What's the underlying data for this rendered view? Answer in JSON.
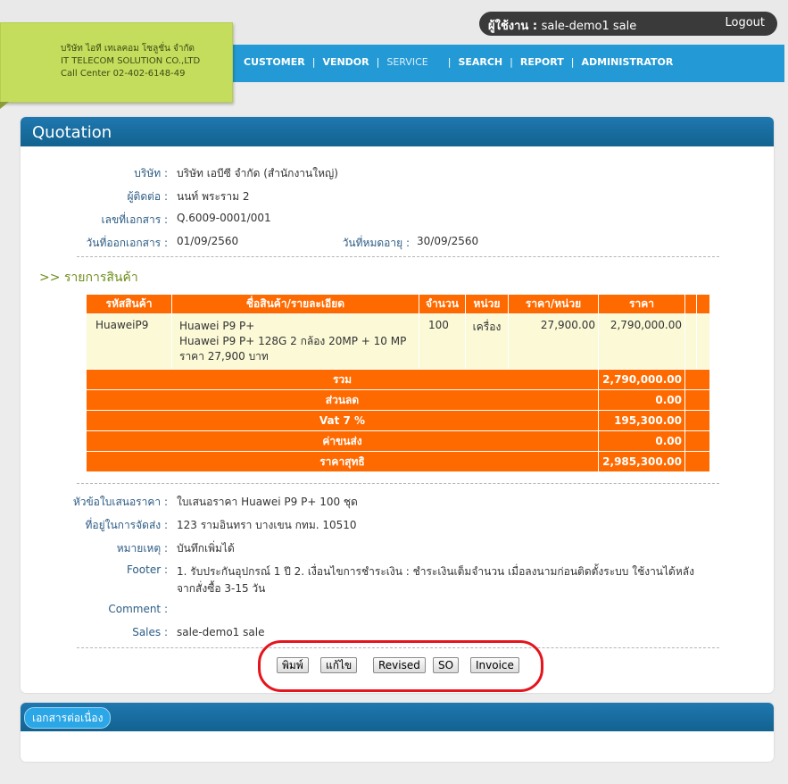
{
  "topbar": {
    "user_label": "ผู้ใช้งาน : ",
    "user_name": "sale-demo1 sale",
    "logout": "Logout"
  },
  "company": {
    "name_th": "บริษัท ไอที เทเลคอม โซลูชั่น จำกัด",
    "name_en": "IT TELECOM SOLUTION CO.,LTD",
    "call_center": "Call Center 02-402-6148-49"
  },
  "nav": {
    "items": [
      "CUSTOMER",
      "VENDOR",
      "SERVICE",
      "SEARCH",
      "REPORT",
      "ADMINISTRATOR"
    ],
    "separator": "|"
  },
  "quotation": {
    "title": "Quotation",
    "company_label": "บริษัท :",
    "company_value": "บริษัท เอบีซี จำกัด (สำนักงานใหญ่)",
    "contact_label": "ผู้ติดต่อ :",
    "contact_value": "นนท์ พระราม 2",
    "doc_no_label": "เลขที่เอกสาร :",
    "doc_no_value": "Q.6009-0001/001",
    "issue_date_label": "วันที่ออกเอกสาร :",
    "issue_date_value": "01/09/2560",
    "expire_date_label": "วันที่หมดอายุ :",
    "expire_date_value": "30/09/2560",
    "section_title": ">> รายการสินค้า"
  },
  "table": {
    "headers": [
      "รหัสสินค้า",
      "ชื่อสินค้า/รายละเอียด",
      "จำนวน",
      "หน่วย",
      "ราคา/หน่วย",
      "ราคา"
    ],
    "row": {
      "code": "HuaweiP9",
      "desc1": "Huawei P9 P+",
      "desc2": "Huawei P9 P+ 128G 2 กล้อง 20MP + 10 MP",
      "desc3": "ราคา 27,900 บาท",
      "qty": "100",
      "unit": "เครื่อง",
      "unit_price": "27,900.00",
      "price": "2,790,000.00"
    },
    "summary": [
      {
        "label": "รวม",
        "value": "2,790,000.00"
      },
      {
        "label": "ส่วนลด",
        "value": "0.00"
      },
      {
        "label": "Vat 7 %",
        "value": "195,300.00"
      },
      {
        "label": "ค่าขนส่ง",
        "value": "0.00"
      },
      {
        "label": "ราคาสุทธิ",
        "value": "2,985,300.00"
      }
    ]
  },
  "details": {
    "subject_label": "หัวข้อใบเสนอราคา :",
    "subject_value": "ใบเสนอราคา Huawei P9 P+ 100 ชุด",
    "address_label": "ที่อยู่ในการจัดส่ง :",
    "address_value": "123 รามอินทรา บางเขน กทม. 10510",
    "note_label": "หมายเหตุ :",
    "note_value": "บันทึกเพิ่มได้",
    "footer_label": "Footer :",
    "footer_line1": "1. รับประกันอุปกรณ์ 1 ปี 2. เงื่อนไขการชำระเงิน : ชำระเงินเต็มจำนวน เมื่อลงนามก่อนติดตั้งระบบ ใช้งานได้หลัง",
    "footer_line2": "จากสั่งซื้อ 3-15 วัน",
    "comment_label": "Comment :",
    "comment_value": "",
    "sales_label": "Sales :",
    "sales_value": "sale-demo1 sale"
  },
  "buttons": {
    "print": "พิมพ์",
    "edit": "แก้ไข",
    "revised": "Revised",
    "so": "SO",
    "invoice": "Invoice"
  },
  "continuation": {
    "title": "เอกสารต่อเนื่อง"
  },
  "colors": {
    "nav_blue": "#239ad5",
    "panel_header": "#12628f",
    "table_orange": "#ff6a00",
    "highlight_red": "#e5141d",
    "company_green": "#c4dd5d"
  }
}
